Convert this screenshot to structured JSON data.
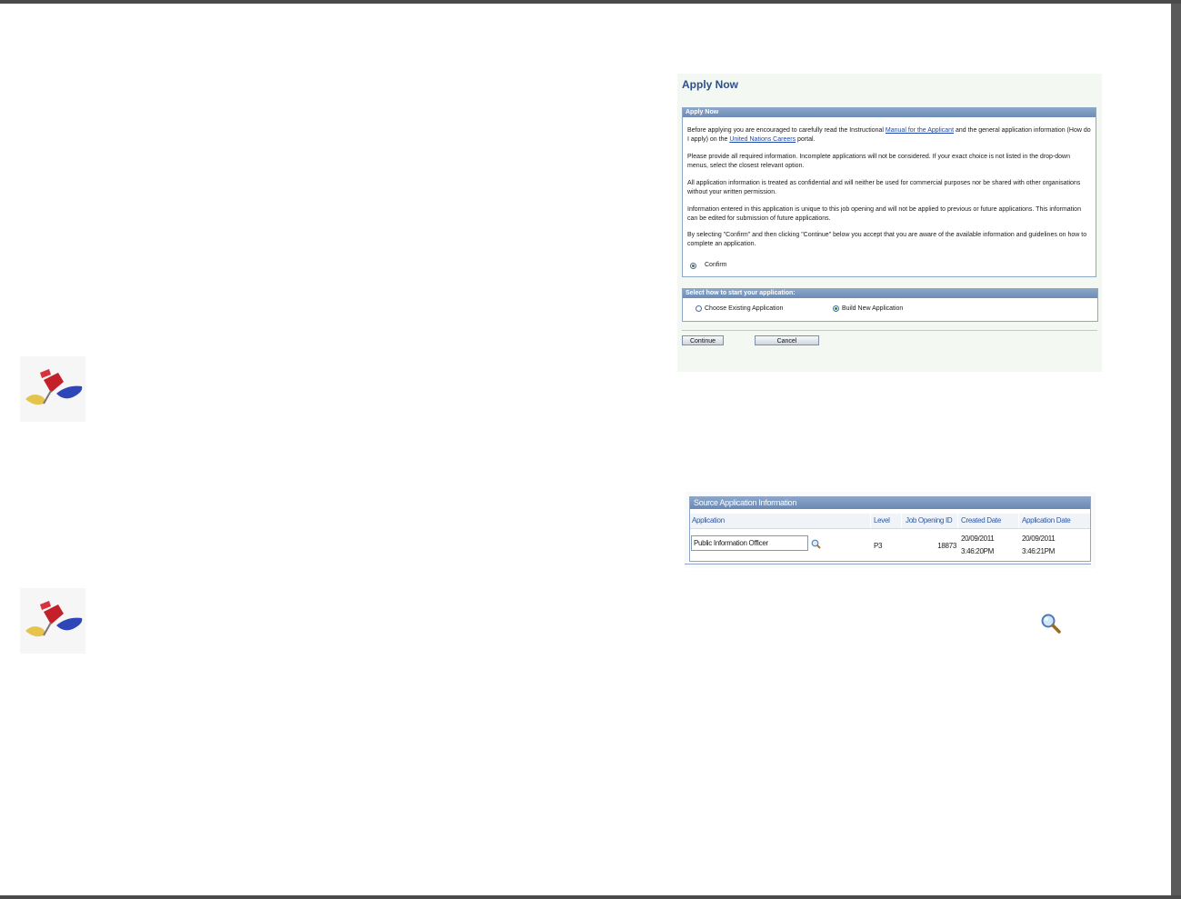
{
  "apply_now": {
    "page_title": "Apply Now",
    "group_title": "Apply Now",
    "para1_before": "Before applying you are encouraged to carefully read the Instructional ",
    "manual_link": "Manual for the Applicant",
    "para1_mid": " and the general application information (How do I apply) on the ",
    "un_link": "United Nations Careers",
    "para1_after": " portal.",
    "para2": "Please provide all required information. Incomplete applications will not be considered. If your exact choice is not listed in the drop-down menus, select the closest relevant option.",
    "para3": "All application information is treated as confidential and will neither be used for commercial purposes nor be shared with other organisations without your written permission.",
    "para4": "Information entered in this application is unique to this job opening and will not be applied to previous or future applications. This information can be edited for submission of future applications.",
    "para5": "By selecting \"Confirm\" and then clicking \"Continue\" below you accept that you are aware of the available information and guidelines on how to complete an application.",
    "confirm_label": "Confirm",
    "confirm_checked": true
  },
  "start_options": {
    "group_title": "Select how to start your application:",
    "existing_label": "Choose Existing Application",
    "new_label": "Build New Application",
    "selected": "new"
  },
  "buttons": {
    "continue_label": "Continue",
    "cancel_label": "Cancel"
  },
  "source_table": {
    "title": "Source Application Information",
    "columns": [
      "Application",
      "Level",
      "Job Opening ID",
      "Created Date",
      "Application Date"
    ],
    "rows": [
      {
        "application": "Public Information Officer",
        "level": "P3",
        "job_opening_id": "18873",
        "created_date": "20/09/2011",
        "created_time": "3:46:20PM",
        "application_date": "20/09/2011",
        "application_time": "3:46:21PM"
      }
    ]
  },
  "icons": {
    "pushpin": "pushpin-icon",
    "lookup": "magnifier-icon"
  }
}
